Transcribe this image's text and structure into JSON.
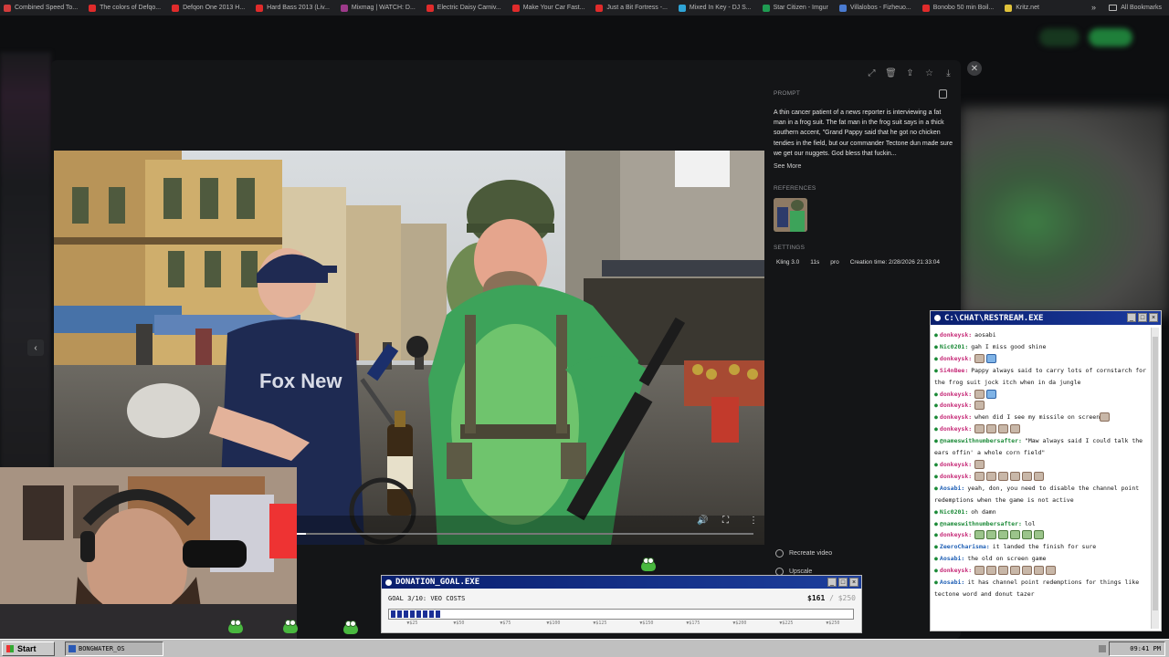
{
  "bookmarks": [
    {
      "label": "Combined Speed To...",
      "color": "#d23c3c"
    },
    {
      "label": "The colors of Defqo...",
      "color": "#e02b2b"
    },
    {
      "label": "Defqon One 2013 H...",
      "color": "#e02b2b"
    },
    {
      "label": "Hard Bass 2013 (Liv...",
      "color": "#e02b2b"
    },
    {
      "label": "Mixmag | WATCH: D...",
      "color": "#9d3a8a"
    },
    {
      "label": "Electric Daisy Carniv...",
      "color": "#e02b2b"
    },
    {
      "label": "Make Your Car Fast...",
      "color": "#e02b2b"
    },
    {
      "label": "Just a Bit Fortress -...",
      "color": "#e02b2b"
    },
    {
      "label": "Mixed In Key - DJ S...",
      "color": "#2fa4d6"
    },
    {
      "label": "Star Citizen - Imgur",
      "color": "#1f9b52"
    },
    {
      "label": "Villalobos - Fizheuo...",
      "color": "#4a7bd1"
    },
    {
      "label": "Bonobo 50 min Boil...",
      "color": "#e02b2b"
    },
    {
      "label": "Kritz.net",
      "color": "#e0c23a"
    }
  ],
  "bookmarks_all": "All Bookmarks",
  "modal": {
    "prompt_label": "PROMPT",
    "prompt_text": "A thin cancer patient of a news reporter is interviewing a fat man in a frog suit. The fat man in the frog suit says in a thick southern accent, \"Grand Pappy said that he got no chicken tendies in the field, but our commander Tectone dun made sure we get our nuggets. God bless that fuckin...",
    "see_more": "See More",
    "references_label": "REFERENCES",
    "settings_label": "SETTINGS",
    "settings": [
      "Kling 3.0",
      "11s",
      "pro",
      "Creation time: 2/28/2026 21:33:04"
    ],
    "recreate": "Recreate video",
    "upscale": "Upscale",
    "video_progress_fraction": 0.02
  },
  "chat": {
    "title": "C:\\CHAT\\RESTREAM.EXE",
    "messages": [
      {
        "user": "donkeysk",
        "user_color": "pink",
        "text": "aosabi",
        "emotes": []
      },
      {
        "user": "Nic0201",
        "user_color": "green",
        "text": "gah I miss good shine",
        "emotes": []
      },
      {
        "user": "donkeysk",
        "user_color": "pink",
        "text": "",
        "emotes": [
          "tan",
          "blue"
        ]
      },
      {
        "user": "Si4nBee",
        "user_color": "pink",
        "text": "Pappy always said to carry lots of cornstarch for the frog suit jock itch when in da jungle",
        "emotes": []
      },
      {
        "user": "donkeysk",
        "user_color": "pink",
        "text": "",
        "emotes": [
          "tan",
          "blue"
        ]
      },
      {
        "user": "donkeysk",
        "user_color": "pink",
        "text": "",
        "emotes": [
          "tan"
        ]
      },
      {
        "user": "donkeysk",
        "user_color": "pink",
        "text": "when did I see my missile on screen",
        "emotes": [
          "tan"
        ]
      },
      {
        "user": "donkeysk",
        "user_color": "pink",
        "text": "",
        "emotes": [
          "tan",
          "tan",
          "tan",
          "tan"
        ]
      },
      {
        "user": "@nameswithnumbersafter",
        "user_color": "green",
        "text": "\"Maw always said I could talk the ears offin' a whole corn field\"",
        "emotes": []
      },
      {
        "user": "donkeysk",
        "user_color": "pink",
        "text": "",
        "emotes": [
          "tan"
        ]
      },
      {
        "user": "donkeysk",
        "user_color": "pink",
        "text": "",
        "emotes": [
          "tan",
          "tan",
          "tan",
          "tan",
          "tan",
          "tan"
        ]
      },
      {
        "user": "Aosabi",
        "user_color": "blue",
        "text": "yeah, don, you need to disable the channel point redemptions when the game is not active",
        "emotes": []
      },
      {
        "user": "Nic0201",
        "user_color": "green",
        "text": "oh damn",
        "emotes": []
      },
      {
        "user": "@nameswithnumbersafter",
        "user_color": "green",
        "text": "lol",
        "emotes": []
      },
      {
        "user": "donkeysk",
        "user_color": "pink",
        "text": "",
        "emotes": [
          "green",
          "green",
          "green",
          "green",
          "green",
          "green"
        ]
      },
      {
        "user": "ZeeroCharisma",
        "user_color": "blue",
        "text": "it landed the finish for sure",
        "emotes": []
      },
      {
        "user": "Aosabi",
        "user_color": "blue",
        "text": "the old on screen game",
        "emotes": []
      },
      {
        "user": "donkeysk",
        "user_color": "pink",
        "text": "",
        "emotes": [
          "tan",
          "tan",
          "tan",
          "tan",
          "tan",
          "tan",
          "tan"
        ]
      },
      {
        "user": "Aosabi",
        "user_color": "blue",
        "text": "it has channel point redemptions for things like tectone word and donut tazer",
        "emotes": []
      }
    ]
  },
  "donation": {
    "title": "DONATION_GOAL.EXE",
    "goal_text": "GOAL 3/10: VEO COSTS",
    "amount": "$161",
    "separator": " / ",
    "target": "$250",
    "progress_fraction": 0.11,
    "ticks": [
      "$25",
      "$50",
      "$75",
      "$100",
      "$125",
      "$150",
      "$175",
      "$200",
      "$225",
      "$250"
    ]
  },
  "taskbar": {
    "start": "Start",
    "app": "BONGWATER_OS",
    "clock": "09:41 PM"
  },
  "icons": {
    "expand": "expand-icon",
    "trash": "trash-icon",
    "share": "share-icon",
    "star": "star-icon",
    "download": "download-icon"
  }
}
